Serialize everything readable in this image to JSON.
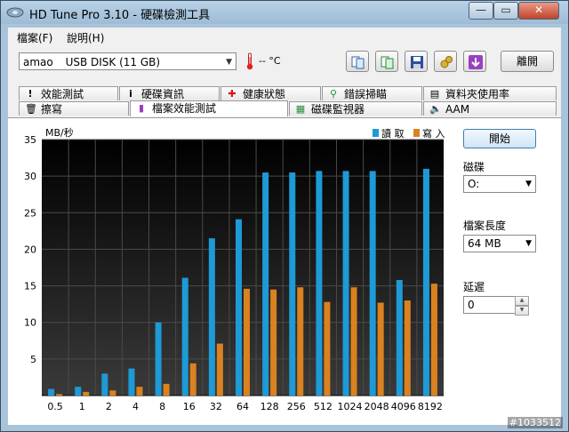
{
  "window": {
    "title": "HD Tune Pro 3.10 - 硬碟檢測工具",
    "minimize_label": "—",
    "maximize_label": "▭",
    "close_label": "✕"
  },
  "menu": [
    {
      "label": "檔案(F)"
    },
    {
      "label": "說明(H)"
    }
  ],
  "toolbar": {
    "drive_name": "amao",
    "drive_selected": "USB DISK (11 GB)",
    "temperature": "-- °C",
    "buttons": [
      "copy-text-icon",
      "copy-screen-icon",
      "save-icon",
      "options-icon",
      "download-icon"
    ],
    "exit_label": "離開",
    "accent_color": "#9b3fc0"
  },
  "tabs": {
    "row1": [
      {
        "label": "效能測試",
        "icon": "exclamation-icon"
      },
      {
        "label": "硬碟資訊",
        "icon": "info-icon"
      },
      {
        "label": "健康狀態",
        "icon": "health-cross-icon"
      },
      {
        "label": "錯誤掃瞄",
        "icon": "magnifier-icon"
      },
      {
        "label": "資料夾使用率",
        "icon": "folder-icon"
      }
    ],
    "row2": [
      {
        "label": "擦寫",
        "icon": "trash-icon"
      },
      {
        "label": "檔案效能測試",
        "icon": "file-icon",
        "active": true
      },
      {
        "label": "磁碟監視器",
        "icon": "monitor-icon"
      },
      {
        "label": "AAM",
        "icon": "speaker-icon"
      }
    ]
  },
  "side": {
    "start_label": "開始",
    "drive_label": "磁碟",
    "drive_value": "O:",
    "file_length_label": "檔案長度",
    "file_length_value": "64 MB",
    "delay_label": "延遲",
    "delay_value": "0"
  },
  "chart_data": {
    "type": "bar",
    "ylabel": "MB/秒",
    "ylim": [
      0,
      35
    ],
    "yticks": [
      5,
      10,
      15,
      20,
      25,
      30,
      35
    ],
    "categories": [
      "0.5",
      "1",
      "2",
      "4",
      "8",
      "16",
      "32",
      "64",
      "128",
      "256",
      "512",
      "1024",
      "2048",
      "4096",
      "8192"
    ],
    "series": [
      {
        "name": "讀 取",
        "color": "#1e9ad6",
        "values": [
          0.9,
          1.2,
          3.0,
          3.7,
          10.0,
          16.1,
          21.5,
          24.1,
          30.5,
          30.5,
          30.7,
          30.7,
          30.7,
          15.8,
          31.0
        ]
      },
      {
        "name": "寫 入",
        "color": "#d9821f",
        "values": [
          0.2,
          0.5,
          0.7,
          1.2,
          1.6,
          4.4,
          7.1,
          14.6,
          14.5,
          14.8,
          12.8,
          14.8,
          12.7,
          13.0,
          15.3
        ]
      }
    ],
    "background": "#000000",
    "grid": true,
    "legend_position": "top-right"
  },
  "watermark": "#1033512"
}
